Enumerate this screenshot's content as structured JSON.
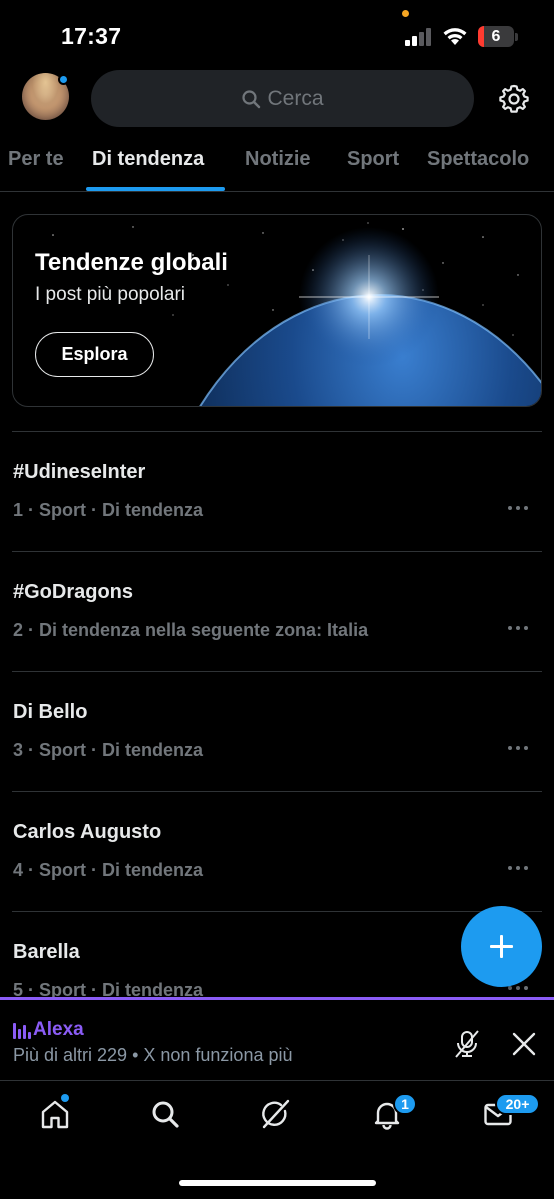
{
  "status_bar": {
    "time": "17:37",
    "battery_level": "6",
    "battery_percent": 0.06,
    "cellular_bars": 2
  },
  "header": {
    "search_placeholder": "Cerca",
    "avatar_has_notification": true
  },
  "tabs": [
    {
      "label": "Per te",
      "active": false
    },
    {
      "label": "Di tendenza",
      "active": true
    },
    {
      "label": "Notizie",
      "active": false
    },
    {
      "label": "Sport",
      "active": false
    },
    {
      "label": "Spettacolo",
      "active": false
    }
  ],
  "hero": {
    "title": "Tendenze globali",
    "subtitle": "I post più popolari",
    "button_label": "Esplora"
  },
  "trends": [
    {
      "name": "#UdineseInter",
      "meta": "1 · Sport · Di tendenza"
    },
    {
      "name": "#GoDragons",
      "meta": "2 · Di tendenza nella seguente zona: Italia"
    },
    {
      "name": "Di Bello",
      "meta": "3 · Sport · Di tendenza"
    },
    {
      "name": "Carlos Augusto",
      "meta": "4 · Sport · Di tendenza"
    },
    {
      "name": "Barella",
      "meta": "5 · Sport · Di tendenza"
    }
  ],
  "player": {
    "name": "Alexa",
    "description": "Più di altri 229 • X non funziona più",
    "accent": "#8b5cf6"
  },
  "nav": {
    "items": [
      "home-icon",
      "search-icon",
      "grok-icon",
      "bell-icon",
      "mail-icon"
    ],
    "notifications_badge": "1",
    "messages_badge": "20+"
  },
  "colors": {
    "accent": "#1d9bf0",
    "background": "#000000",
    "muted": "#71767b"
  }
}
